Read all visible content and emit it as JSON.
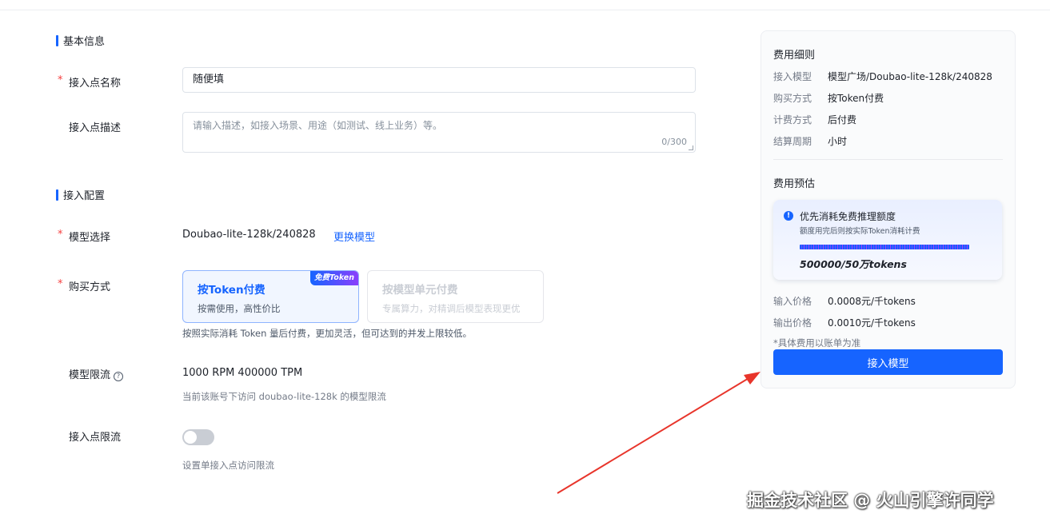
{
  "basic_section": {
    "title": "基本信息"
  },
  "endpoint_name": {
    "label": "接入点名称",
    "required_mark": "*",
    "value": "随便填"
  },
  "endpoint_desc": {
    "label": "接入点描述",
    "placeholder": "请输入描述，如接入场景、用途（如测试、线上业务）等。",
    "counter": "0/300"
  },
  "config_section": {
    "title": "接入配置"
  },
  "model_select": {
    "label": "模型选择",
    "required_mark": "*",
    "value": "Doubao-lite-128k/240828",
    "change_link": "更换模型"
  },
  "purchase": {
    "label": "购买方式",
    "required_mark": "*",
    "options": [
      {
        "title": "按Token付费",
        "subtitle": "按需使用，高性价比",
        "badge": "免费Token",
        "selected": true
      },
      {
        "title": "按模型单元付费",
        "subtitle": "专属算力，对精调后模型表现更优",
        "selected": false
      }
    ],
    "hint": "按照实际消耗 Token 量后付费，更加灵活，但可达到的并发上限较低。"
  },
  "rate_limit": {
    "label": "模型限流",
    "help_glyph": "?",
    "value": "1000 RPM 400000 TPM",
    "hint": "当前该账号下访问 doubao-lite-128k 的模型限流"
  },
  "endpoint_limit": {
    "label": "接入点限流",
    "enabled": false,
    "hint": "设置单接入点访问限流"
  },
  "fees": {
    "title": "费用细则",
    "rows": [
      {
        "key": "接入模型",
        "value": "模型广场/Doubao-lite-128k/240828"
      },
      {
        "key": "购买方式",
        "value": "按Token付费"
      },
      {
        "key": "计费方式",
        "value": "后付费"
      },
      {
        "key": "结算周期",
        "value": "小时"
      }
    ]
  },
  "estimate": {
    "title": "费用预估",
    "quota": {
      "info_glyph": "!",
      "title": "优先消耗免费推理额度",
      "subtitle": "额度用完后则按实际Token消耗计费",
      "value": "500000/50万tokens",
      "fraction_used": 1.0
    },
    "prices": [
      {
        "key": "输入价格",
        "value": "0.0008元/千tokens"
      },
      {
        "key": "输出价格",
        "value": "0.0010元/千tokens"
      }
    ],
    "note": "*具体费用以账单为准",
    "button": "接入模型"
  },
  "watermark": "掘金技术社区 @ 火山引擎许同学",
  "colors": {
    "accent": "#1664ff",
    "required": "#f53f3f",
    "arrow": "#e8352b"
  }
}
